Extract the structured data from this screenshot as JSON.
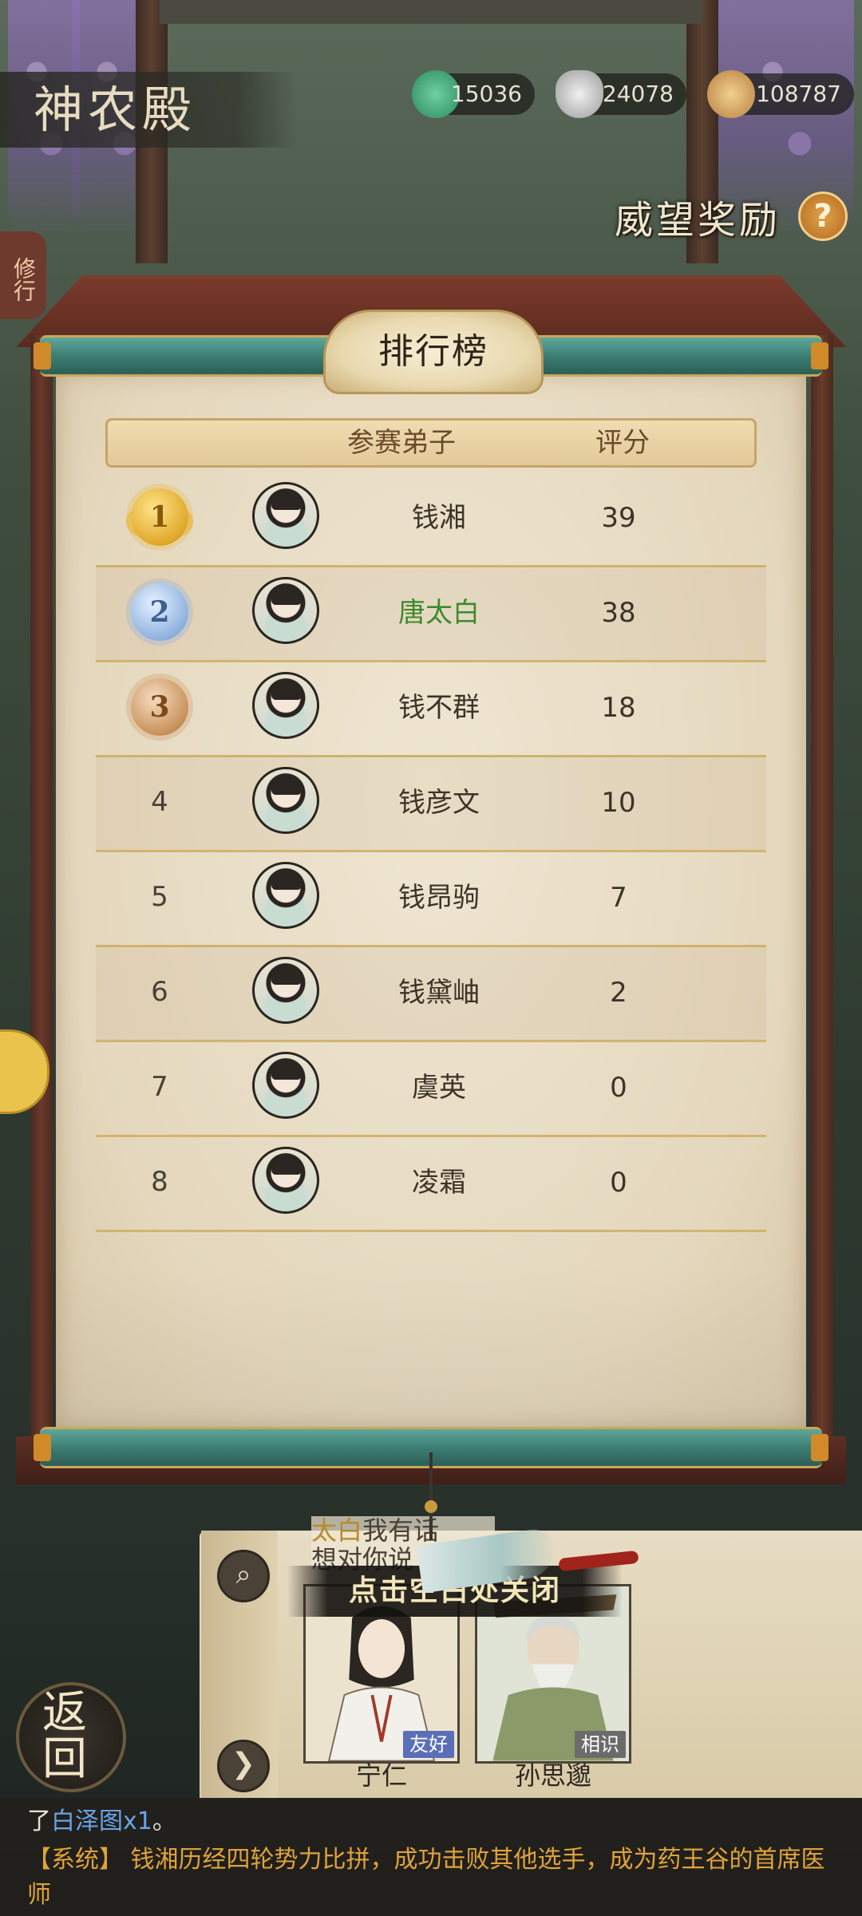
{
  "location": {
    "title": "神农殿"
  },
  "currencies": [
    {
      "icon": "jade-coin-icon",
      "value": "15036",
      "color": "#3aa87a"
    },
    {
      "icon": "silver-ingot-icon",
      "value": "24078",
      "color": "#c8c8c8"
    },
    {
      "icon": "copper-coins-icon",
      "value": "108787",
      "color": "#d0a060"
    }
  ],
  "reputation": {
    "label": "威望奖励",
    "help": "?"
  },
  "side_tab": {
    "label": "修行"
  },
  "leaderboard": {
    "title": "排行榜",
    "header": {
      "disciple": "参赛弟子",
      "score": "评分"
    },
    "rows": [
      {
        "rank": "1",
        "name": "钱湘",
        "score": "39",
        "badge": "gold"
      },
      {
        "rank": "2",
        "name": "唐太白",
        "score": "38",
        "badge": "silver",
        "highlight": true
      },
      {
        "rank": "3",
        "name": "钱不群",
        "score": "18",
        "badge": "bronze"
      },
      {
        "rank": "4",
        "name": "钱彦文",
        "score": "10"
      },
      {
        "rank": "5",
        "name": "钱昂驹",
        "score": "7"
      },
      {
        "rank": "6",
        "name": "钱黛岫",
        "score": "2"
      },
      {
        "rank": "7",
        "name": "虞英",
        "score": "0"
      },
      {
        "rank": "8",
        "name": "凌霜",
        "score": "0"
      }
    ]
  },
  "close_hint": "点击空白处关闭",
  "dialog": {
    "name": "太白",
    "text": "我有话",
    "line2": "想对你说"
  },
  "npcs": [
    {
      "name": "宁仁",
      "tag": "友好",
      "tag_color": "#5b6fb8"
    },
    {
      "name": "孙思邈",
      "tag": "相识",
      "tag_color": "#6b6b6b"
    }
  ],
  "back_button": {
    "label": "返回"
  },
  "chat": {
    "line1_prefix": "了",
    "line1_item": "白泽图x1",
    "line1_suffix": "。",
    "system_tag": "【系统】",
    "line2_a": "钱湘历经四轮势力比拼，成功击败其他选手，成为",
    "line2_place": "药王谷",
    "line2_b": "的首席医师"
  }
}
